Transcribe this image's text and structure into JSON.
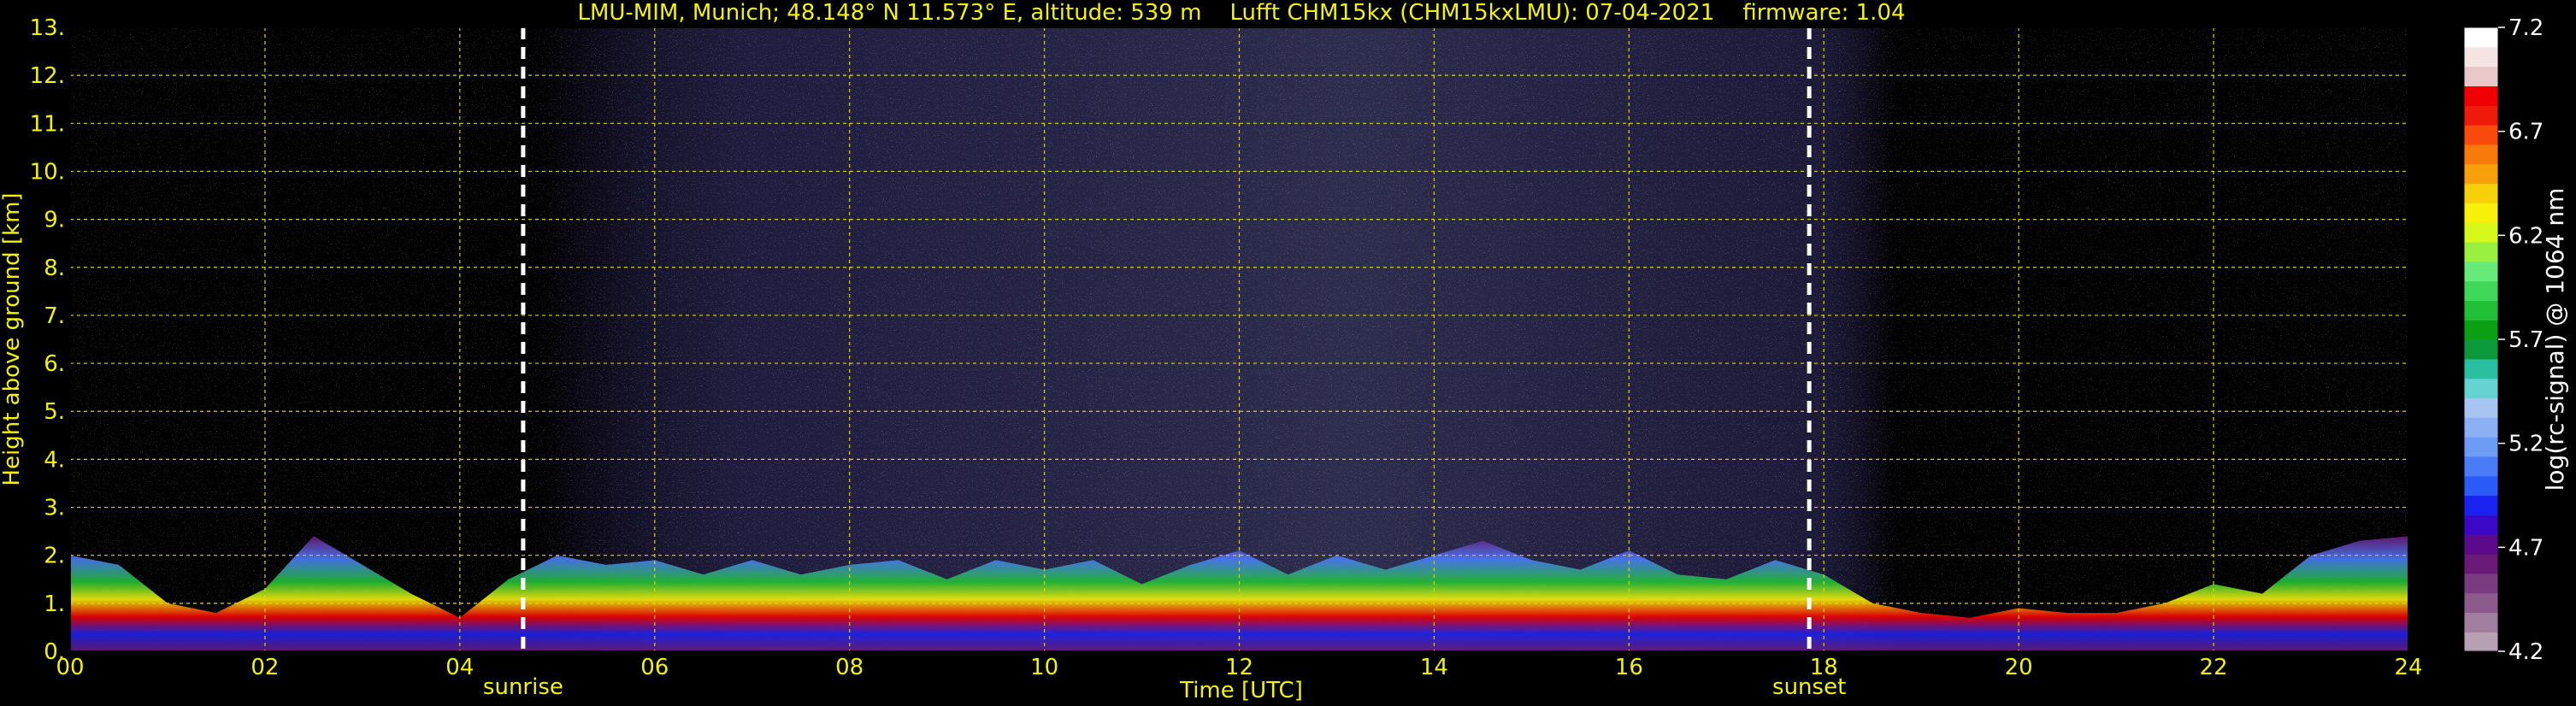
{
  "chart_data": {
    "type": "heatmap",
    "title": "LMU-MIM, Munich; 48.148° N 11.573° E, altitude: 539 m    Lufft CHM15kx (CHM15kxLMU): 07-04-2021    firmware: 1.04",
    "xlabel": "Time [UTC]",
    "ylabel": "Height above ground [km]",
    "xlim": [
      0,
      24
    ],
    "ylim": [
      0,
      13
    ],
    "x_ticks": [
      "00",
      "02",
      "04",
      "06",
      "08",
      "10",
      "12",
      "14",
      "16",
      "18",
      "20",
      "22",
      "24"
    ],
    "y_ticks": [
      "0.",
      "1.",
      "2.",
      "3.",
      "4.",
      "5.",
      "6.",
      "7.",
      "8.",
      "9.",
      "10.",
      "11.",
      "12.",
      "13."
    ],
    "grid": true,
    "colorbar": {
      "label": "log(rc-signal) @ 1064 nm",
      "range": [
        4.2,
        7.2
      ],
      "ticks": [
        "4.2",
        "4.7",
        "5.2",
        "5.7",
        "6.2",
        "6.7",
        "7.2"
      ],
      "colors": [
        "#b8a0b4",
        "#a07ea0",
        "#8c5a8c",
        "#7a3a80",
        "#6a1a78",
        "#5a0a8a",
        "#3c08c8",
        "#1a22f0",
        "#2a5af8",
        "#4a7cf8",
        "#6c9cf6",
        "#8cb0f4",
        "#a8c4f0",
        "#66d2d2",
        "#28c0a0",
        "#0a9a3c",
        "#0aa014",
        "#22c034",
        "#40d858",
        "#66ea7a",
        "#9af040",
        "#d6f81a",
        "#f8f00a",
        "#f8d00a",
        "#f8a00a",
        "#f87a0a",
        "#f84a0a",
        "#f01a0a",
        "#f00000",
        "#e8c8c8",
        "#f4e4e4",
        "#ffffff"
      ]
    },
    "annotations": [
      {
        "text": "sunrise",
        "x": 4.65
      },
      {
        "text": "sunset",
        "x": 17.85
      }
    ],
    "cloud_top_height_km": [
      [
        0,
        2.0
      ],
      [
        0.5,
        1.8
      ],
      [
        1.0,
        1.0
      ],
      [
        1.5,
        0.8
      ],
      [
        2.0,
        1.3
      ],
      [
        2.5,
        2.4
      ],
      [
        3.0,
        1.8
      ],
      [
        3.5,
        1.2
      ],
      [
        4.0,
        0.7
      ],
      [
        4.5,
        1.5
      ],
      [
        5.0,
        2.0
      ],
      [
        5.5,
        1.8
      ],
      [
        6.0,
        1.9
      ],
      [
        6.5,
        1.6
      ],
      [
        7.0,
        1.9
      ],
      [
        7.5,
        1.6
      ],
      [
        8.0,
        1.8
      ],
      [
        8.5,
        1.9
      ],
      [
        9.0,
        1.5
      ],
      [
        9.5,
        1.9
      ],
      [
        10.0,
        1.7
      ],
      [
        10.5,
        1.9
      ],
      [
        11.0,
        1.4
      ],
      [
        11.5,
        1.8
      ],
      [
        12.0,
        2.1
      ],
      [
        12.5,
        1.6
      ],
      [
        13.0,
        2.0
      ],
      [
        13.5,
        1.7
      ],
      [
        14.0,
        2.0
      ],
      [
        14.5,
        2.3
      ],
      [
        15.0,
        1.9
      ],
      [
        15.5,
        1.7
      ],
      [
        16.0,
        2.1
      ],
      [
        16.5,
        1.6
      ],
      [
        17.0,
        1.5
      ],
      [
        17.5,
        1.9
      ],
      [
        18.0,
        1.6
      ],
      [
        18.5,
        1.0
      ],
      [
        19.0,
        0.8
      ],
      [
        19.5,
        0.7
      ],
      [
        20.0,
        0.9
      ],
      [
        20.5,
        0.8
      ],
      [
        21.0,
        0.8
      ],
      [
        21.5,
        1.0
      ],
      [
        22.0,
        1.4
      ],
      [
        22.5,
        1.2
      ],
      [
        23.0,
        2.0
      ],
      [
        23.5,
        2.3
      ],
      [
        24.0,
        2.4
      ]
    ]
  }
}
